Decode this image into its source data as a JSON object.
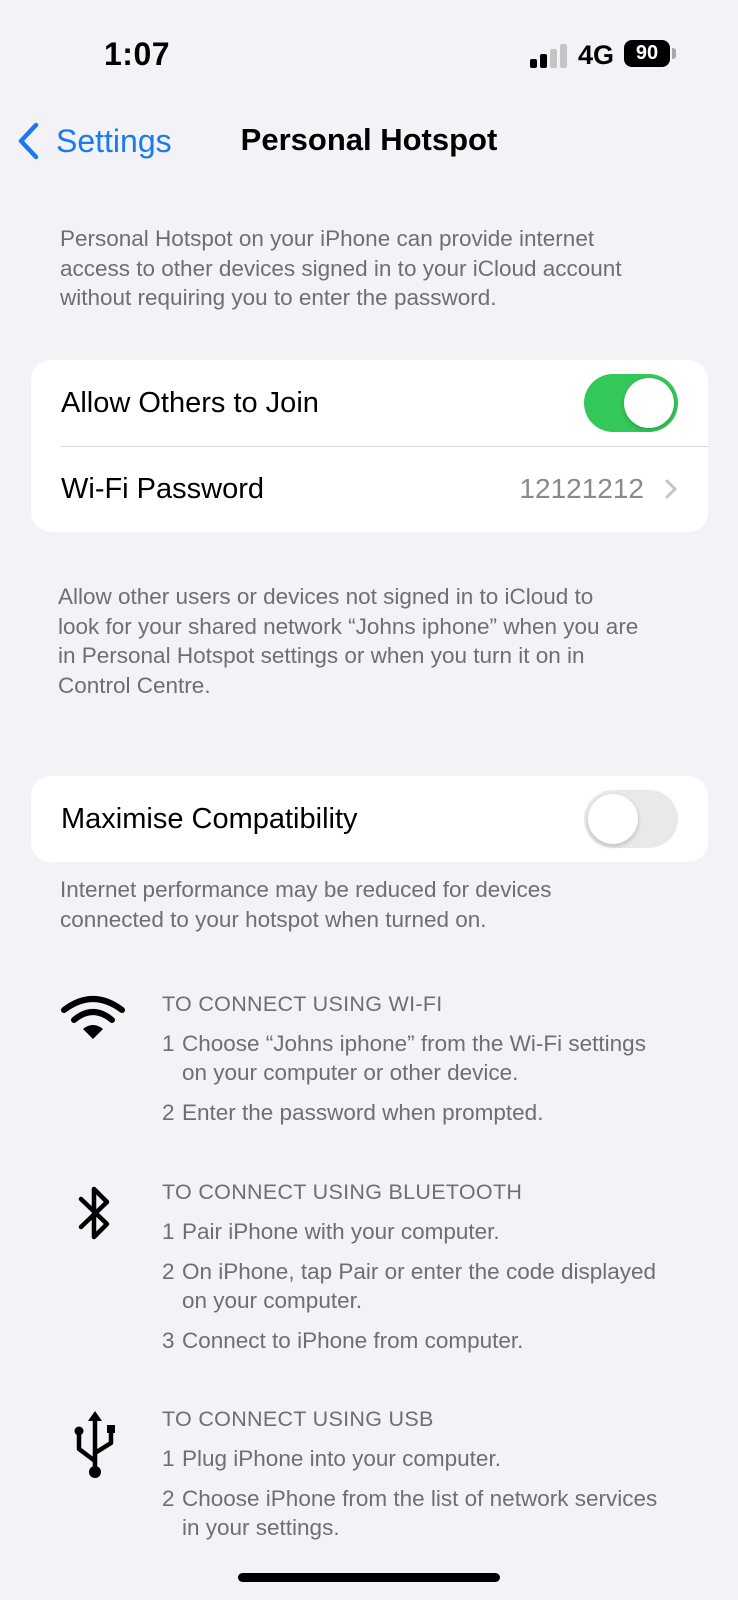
{
  "status_bar": {
    "time": "1:07",
    "network": "4G",
    "battery": "90",
    "signal_bars_active": 2,
    "signal_bars_total": 4
  },
  "nav": {
    "back_label": "Settings",
    "title": "Personal Hotspot"
  },
  "intro_note": [
    "Personal Hotspot on your iPhone can provide internet",
    "access to other devices signed in to your iCloud account",
    "without requiring you to enter the password."
  ],
  "main_group": {
    "allow_others": {
      "label": "Allow Others to Join",
      "state": "on"
    },
    "wifi_password": {
      "label": "Wi-Fi Password",
      "value": "12121212"
    }
  },
  "allow_note": [
    "Allow other users or devices not signed in to iCloud to",
    "look for your shared network “Johns iphone” when you are",
    "in Personal Hotspot settings or when you turn it on in",
    "Control Centre."
  ],
  "compat_group": {
    "maximise": {
      "label": "Maximise Compatibility",
      "state": "off"
    }
  },
  "compat_note": [
    "Internet performance may be reduced for devices",
    "connected to your hotspot when turned on."
  ],
  "connect_sections": [
    {
      "icon": "wifi-icon",
      "heading": "TO CONNECT USING WI-FI",
      "steps": [
        {
          "num": "1",
          "text": "Choose “Johns iphone” from the Wi-Fi settings\non your computer or other device."
        },
        {
          "num": "2",
          "text": "Enter the password when prompted."
        }
      ]
    },
    {
      "icon": "bluetooth-icon",
      "heading": "TO CONNECT USING BLUETOOTH",
      "steps": [
        {
          "num": "1",
          "text": "Pair iPhone with your computer."
        },
        {
          "num": "2",
          "text": "On iPhone, tap Pair or enter the code displayed\non your computer."
        },
        {
          "num": "3",
          "text": "Connect to iPhone from computer."
        }
      ]
    },
    {
      "icon": "usb-icon",
      "heading": "TO CONNECT USING USB",
      "steps": [
        {
          "num": "1",
          "text": "Plug iPhone into your computer."
        },
        {
          "num": "2",
          "text": "Choose iPhone from the list of network services\nin your settings."
        }
      ]
    }
  ],
  "colors": {
    "accent": "#1a7bf0",
    "toggle_on": "#34c759",
    "background": "#f2f2f7",
    "secondary_text": "#6e6e73"
  }
}
